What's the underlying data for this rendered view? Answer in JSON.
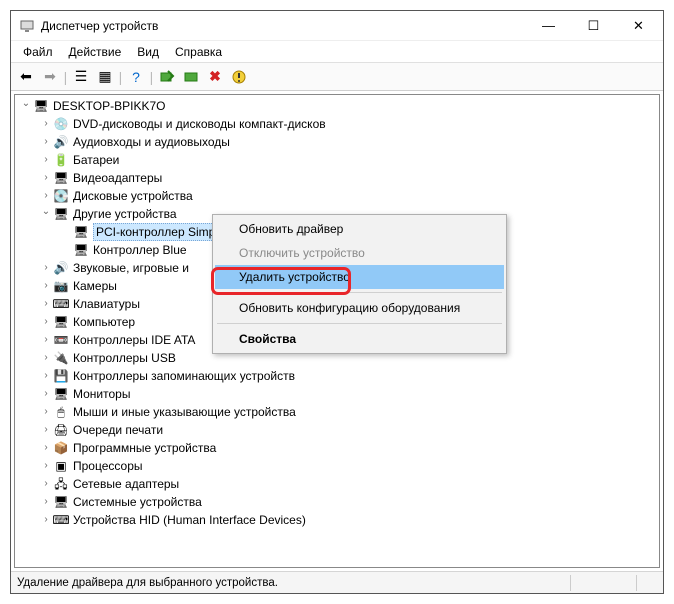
{
  "window": {
    "title": "Диспетчер устройств"
  },
  "menubar": {
    "file": "Файл",
    "action": "Действие",
    "view": "Вид",
    "help": "Справка"
  },
  "tree": {
    "root": "DESKTOP-BPIKK7O",
    "items": [
      {
        "label": "DVD-дисководы и дисководы компакт-дисков",
        "icon": "💿"
      },
      {
        "label": "Аудиовходы и аудиовыходы",
        "icon": "🔊"
      },
      {
        "label": "Батареи",
        "icon": "🔋"
      },
      {
        "label": "Видеоадаптеры",
        "icon": "🖥"
      },
      {
        "label": "Дисковые устройства",
        "icon": "💽"
      }
    ],
    "open_node": {
      "label": "Другие устройства",
      "icon": "🖥",
      "children": [
        {
          "label": "PCI-контроллер Simple Communications",
          "icon": "🖥",
          "selected": true
        },
        {
          "label": "Контроллер Blue",
          "icon": "🖥"
        }
      ]
    },
    "items2": [
      {
        "label": "Звуковые, игровые и",
        "icon": "🔊"
      },
      {
        "label": "Камеры",
        "icon": "📷"
      },
      {
        "label": "Клавиатуры",
        "icon": "⌨"
      },
      {
        "label": "Компьютер",
        "icon": "🖥"
      },
      {
        "label": "Контроллеры IDE ATA",
        "icon": "📼"
      },
      {
        "label": "Контроллеры USB",
        "icon": "🔌"
      },
      {
        "label": "Контроллеры запоминающих устройств",
        "icon": "💾"
      },
      {
        "label": "Мониторы",
        "icon": "🖥"
      },
      {
        "label": "Мыши и иные указывающие устройства",
        "icon": "🖱"
      },
      {
        "label": "Очереди печати",
        "icon": "🖨"
      },
      {
        "label": "Программные устройства",
        "icon": "📦"
      },
      {
        "label": "Процессоры",
        "icon": "▣"
      },
      {
        "label": "Сетевые адаптеры",
        "icon": "🖧"
      },
      {
        "label": "Системные устройства",
        "icon": "🖥"
      },
      {
        "label": "Устройства HID (Human Interface Devices)",
        "icon": "⌨"
      }
    ]
  },
  "context": {
    "update": "Обновить драйвер",
    "disable": "Отключить устройство",
    "remove": "Удалить устройство",
    "refresh": "Обновить конфигурацию оборудования",
    "props": "Свойства"
  },
  "status": "Удаление драйвера для выбранного устройства."
}
